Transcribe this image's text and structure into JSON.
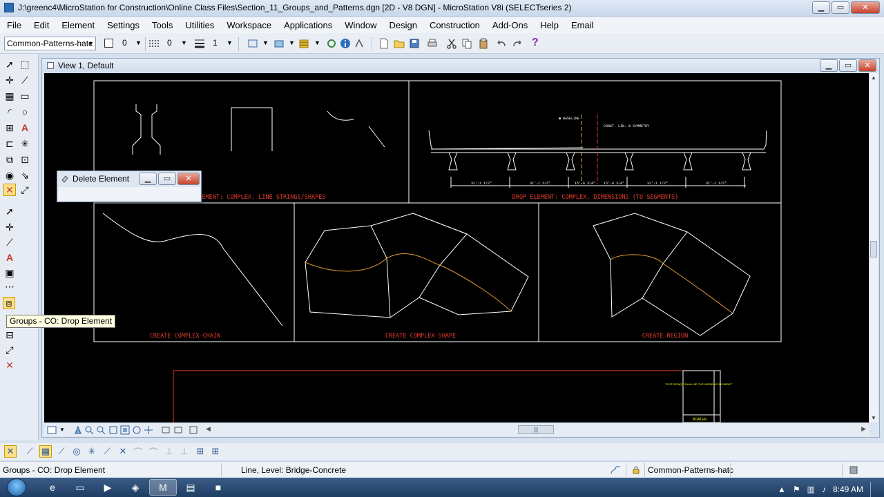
{
  "window": {
    "title": "J:\\greenc4\\MicroStation for Construction\\Online Class Files\\Section_11_Groups_and_Patterns.dgn [2D - V8 DGN] - MicroStation V8i (SELECTseries 2)",
    "minimize": "▁",
    "maximize": "▭",
    "close": "✕"
  },
  "menu": [
    "File",
    "Edit",
    "Element",
    "Settings",
    "Tools",
    "Utilities",
    "Workspace",
    "Applications",
    "Window",
    "Design",
    "Construction",
    "Add-Ons",
    "Help",
    "Email"
  ],
  "toolbar": {
    "level": "Common-Patterns-hatc",
    "color": "0",
    "style": "0",
    "weight": "1",
    "help_icon": "?"
  },
  "view": {
    "title": "View 1, Default"
  },
  "dialog": {
    "title": "Delete Element"
  },
  "tooltip": "Groups - CO: Drop Element",
  "drawing": {
    "cell_labels": [
      "DROP ELEMENT: COMPLEX, LINE STRINGS/SHAPES",
      "DROP ELEMENT: COMPLEX, DIMENSIONS (TO SEGMENTS)",
      "CREATE COMPLEX CHAIN",
      "CREATE COMPLEX SHAPE",
      "CREATE REGION"
    ],
    "dim_labels": [
      "31'-1 1/2\"",
      "31'-1 1/2\"",
      "15'-6 3/4\"",
      "15'-6 3/4\"",
      "31'-1 1/2\"",
      "31'-1 1/2\""
    ],
    "annot_1": "■ BASELINE",
    "annot_2": "CONST. LIN. & SYMMETRY",
    "sheet_note": "\"EXIT SIGN(S) SHALL BE THE WORKING ELEMENT\"",
    "sheet_name": "BOATER"
  },
  "statusbar": {
    "prompt": "Groups - CO: Drop Element",
    "message": "Line, Level: Bridge-Concrete",
    "level": "Common-Patterns-hatc"
  },
  "taskbar": {
    "time": "8:49 AM"
  },
  "colors": {
    "canvas": "#000000",
    "drawing_white": "#ffffff",
    "drawing_red": "#e23b2e",
    "drawing_orange": "#e0a030",
    "drawing_yellow": "#ffff00"
  }
}
